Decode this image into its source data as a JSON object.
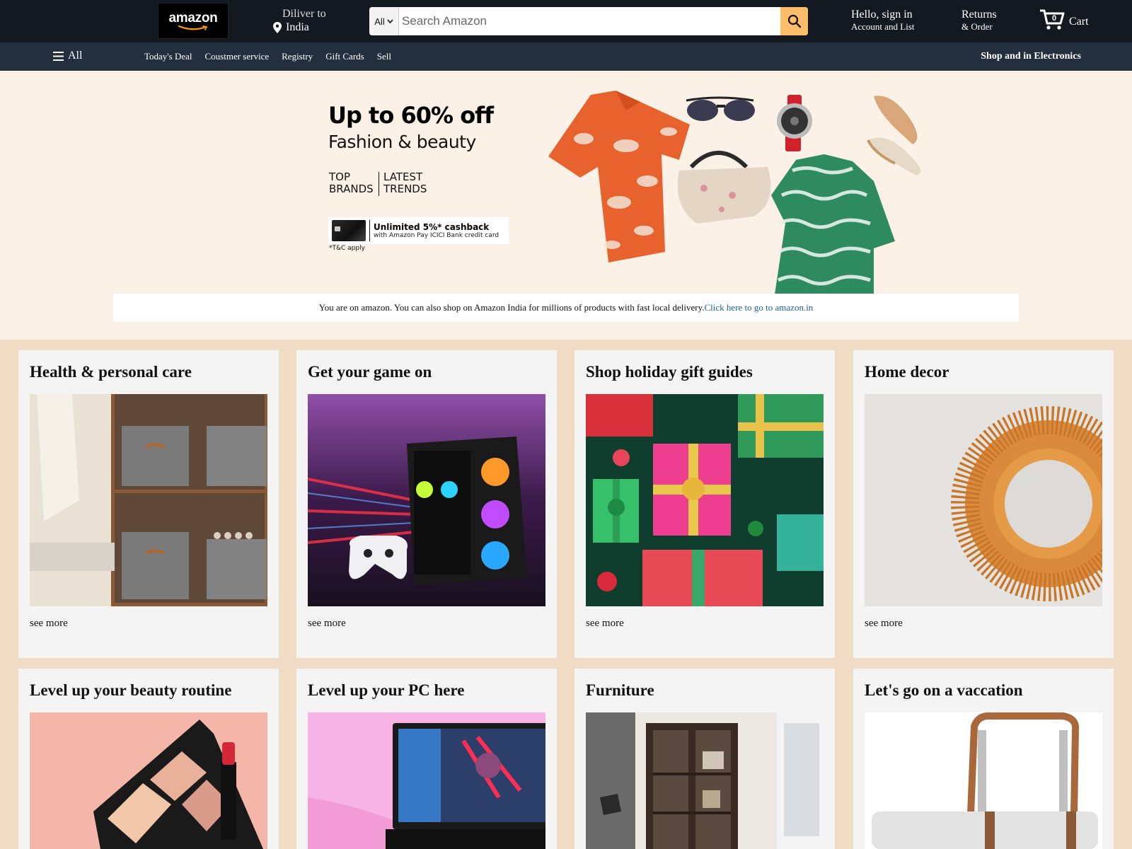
{
  "header": {
    "logo_text": "amazon",
    "deliver_label": "Diliver to",
    "deliver_location": "India",
    "search": {
      "category": "All",
      "placeholder": "Search Amazon"
    },
    "signin_line1": "Hello, sign in",
    "signin_line2": "Account and List",
    "returns_line1": "Returns",
    "returns_line2": "& Order",
    "cart_label": "Cart",
    "cart_count": "0"
  },
  "subnav": {
    "all_label": "All",
    "links": [
      "Today's Deal",
      "Coustmer service",
      "Registry",
      "Gift Cards",
      "Sell"
    ],
    "right_link": "Shop and in Electronics"
  },
  "hero": {
    "headline": "Up to 60% off",
    "subheadline": "Fashion & beauty",
    "tag1_line1": "TOP",
    "tag1_line2": "BRANDS",
    "tag2_line1": "LATEST",
    "tag2_line2": "TRENDS",
    "cashback_title": "Unlimited 5%* cashback",
    "cashback_sub": "with Amazon Pay ICICI Bank credit card",
    "tnc": "*T&C apply",
    "notice_text": "You are on amazon. You can also shop on Amazon India for millions of products with fast local delivery.",
    "notice_link": "Click here to go to amazon.in"
  },
  "cards": [
    {
      "title": "Health & personal care",
      "more": "see more"
    },
    {
      "title": "Get your game on",
      "more": "see more"
    },
    {
      "title": "Shop holiday gift guides",
      "more": "see more"
    },
    {
      "title": "Home decor",
      "more": "see more"
    },
    {
      "title": "Level up your beauty routine",
      "more": "see more"
    },
    {
      "title": "Level up your PC here",
      "more": "see more"
    },
    {
      "title": "Furniture",
      "more": "see more"
    },
    {
      "title": "Let's go on a vaccation",
      "more": "see more"
    }
  ],
  "colors": {
    "topbar": "#131921",
    "subnav": "#232f3e",
    "search_button": "#febd69",
    "page_bg": "#f0dcc4",
    "hero_bg": "#fcf1e7",
    "link": "#1a6396"
  }
}
